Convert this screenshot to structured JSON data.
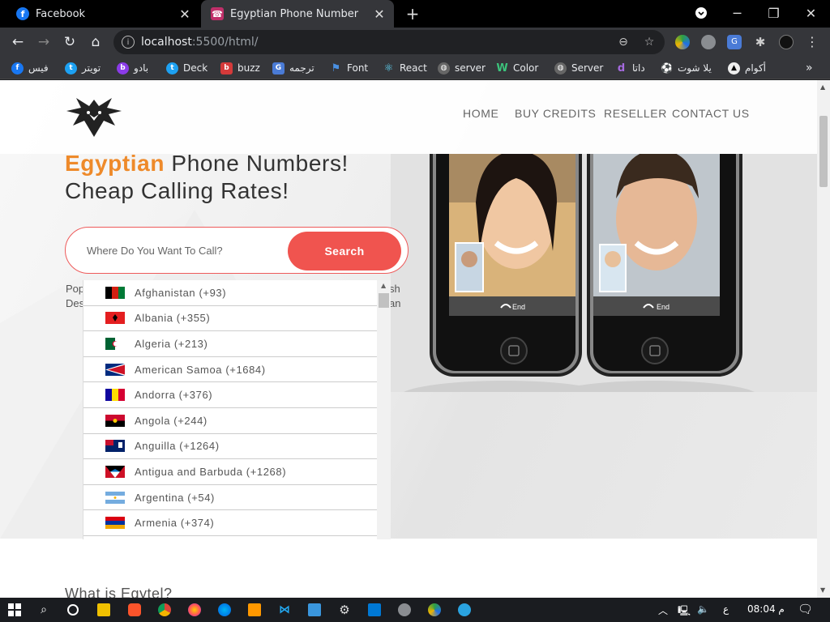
{
  "tabs": [
    {
      "title": "Facebook",
      "icon": "facebook-icon"
    },
    {
      "title": "Egyptian Phone Number",
      "icon": "site-icon"
    }
  ],
  "address": {
    "host": "localhost",
    "rest": ":5500/html/"
  },
  "bookmarks": [
    {
      "label": "فيس",
      "icon": "facebook-icon"
    },
    {
      "label": "تويتر",
      "icon": "twitter-icon"
    },
    {
      "label": "بادو",
      "icon": "badoo-icon"
    },
    {
      "label": "Deck",
      "icon": "twitter-icon"
    },
    {
      "label": "buzz",
      "icon": "buzz-icon"
    },
    {
      "label": "ترجمه",
      "icon": "translate-icon"
    },
    {
      "label": "Font",
      "icon": "flag-icon"
    },
    {
      "label": "React",
      "icon": "react-icon"
    },
    {
      "label": "server",
      "icon": "globe-icon"
    },
    {
      "label": "Color",
      "icon": "w-icon"
    },
    {
      "label": "Server",
      "icon": "globe-icon"
    },
    {
      "label": "داتا",
      "icon": "d-icon"
    },
    {
      "label": "يلا شوت",
      "icon": "ball-icon"
    },
    {
      "label": "أكوام",
      "icon": "triangle-icon"
    }
  ],
  "nav": {
    "home": "HOME",
    "buy": "BUY CREDITS",
    "reseller": "RESELLER",
    "contact": "CONTACT US"
  },
  "hero": {
    "title_highlight": "Egyptian",
    "title_rest": " Phone Numbers!",
    "title_line2": "Cheap Calling Rates!",
    "search_placeholder": "Where Do You Want To Call?",
    "search_button": "Search",
    "peek_left_1": "Pop",
    "peek_left_2": "Des",
    "peek_right_1": "sh",
    "peek_right_2": "an"
  },
  "countries": [
    {
      "label": "Afghanistan (+93)",
      "flag": "af"
    },
    {
      "label": "Albania (+355)",
      "flag": "al"
    },
    {
      "label": "Algeria (+213)",
      "flag": "dz"
    },
    {
      "label": "American Samoa (+1684)",
      "flag": "as"
    },
    {
      "label": "Andorra (+376)",
      "flag": "ad"
    },
    {
      "label": "Angola (+244)",
      "flag": "ao"
    },
    {
      "label": "Anguilla (+1264)",
      "flag": "ai"
    },
    {
      "label": "Antigua and Barbuda (+1268)",
      "flag": "ag"
    },
    {
      "label": "Argentina (+54)",
      "flag": "ar"
    },
    {
      "label": "Armenia (+374)",
      "flag": "am"
    }
  ],
  "phones": {
    "end_label": "End"
  },
  "section": {
    "title": "What is Egytel?"
  },
  "tray": {
    "lang": "ع",
    "time": "08:04 م"
  },
  "colors": {
    "accent": "#f0544f",
    "highlight": "#ee8a2a",
    "tab_active": "#35363a"
  }
}
